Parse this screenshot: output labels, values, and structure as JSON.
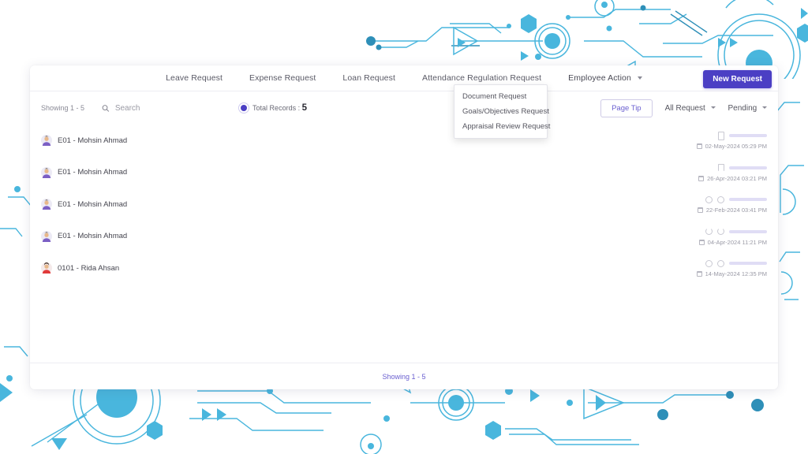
{
  "nav": {
    "items": [
      {
        "label": "Leave Request",
        "active": false
      },
      {
        "label": "Expense Request",
        "active": false
      },
      {
        "label": "Loan Request",
        "active": false
      },
      {
        "label": "Attendance Regulation Request",
        "active": false
      },
      {
        "label": "Employee Action",
        "active": true,
        "has_caret": true
      }
    ],
    "new_request_label": "New Request",
    "accent_color": "#4b3fc4"
  },
  "dropdown": {
    "items": [
      {
        "label": "Document Request"
      },
      {
        "label": "Goals/Objectives Request"
      },
      {
        "label": "Appraisal Review Request"
      }
    ]
  },
  "toolbar": {
    "showing_label": "Showing 1 - 5",
    "search_placeholder": "Search",
    "search_value": "",
    "search_icon": "search-icon",
    "total_records_label": "Total Records : ",
    "total_records_value": "5",
    "page_tip_label": "Page Tip",
    "request_filter_label": "All Request",
    "status_filter_label": "Pending"
  },
  "rows": [
    {
      "name": "E01 - Mohsin Ahmad",
      "avatar_color": "#7b5fc4",
      "date": "02-May-2024 05:29 PM",
      "placeholder": "document"
    },
    {
      "name": "E01 - Mohsin Ahmad",
      "avatar_color": "#7b5fc4",
      "date": "26-Apr-2024 03:21 PM",
      "placeholder": "document-open"
    },
    {
      "name": "E01 - Mohsin Ahmad",
      "avatar_color": "#7b5fc4",
      "date": "22-Feb-2024 03:41 PM",
      "placeholder": "rings"
    },
    {
      "name": "E01 - Mohsin Ahmad",
      "avatar_color": "#7b5fc4",
      "date": "04-Apr-2024 11:21 PM",
      "placeholder": "rings-partial"
    },
    {
      "name": "0101 - Rida Ahsan",
      "avatar_color": "#e03a3a",
      "date": "14-May-2024 12:35 PM",
      "placeholder": "rings"
    }
  ],
  "footer": {
    "text": "Showing 1 - 5"
  }
}
